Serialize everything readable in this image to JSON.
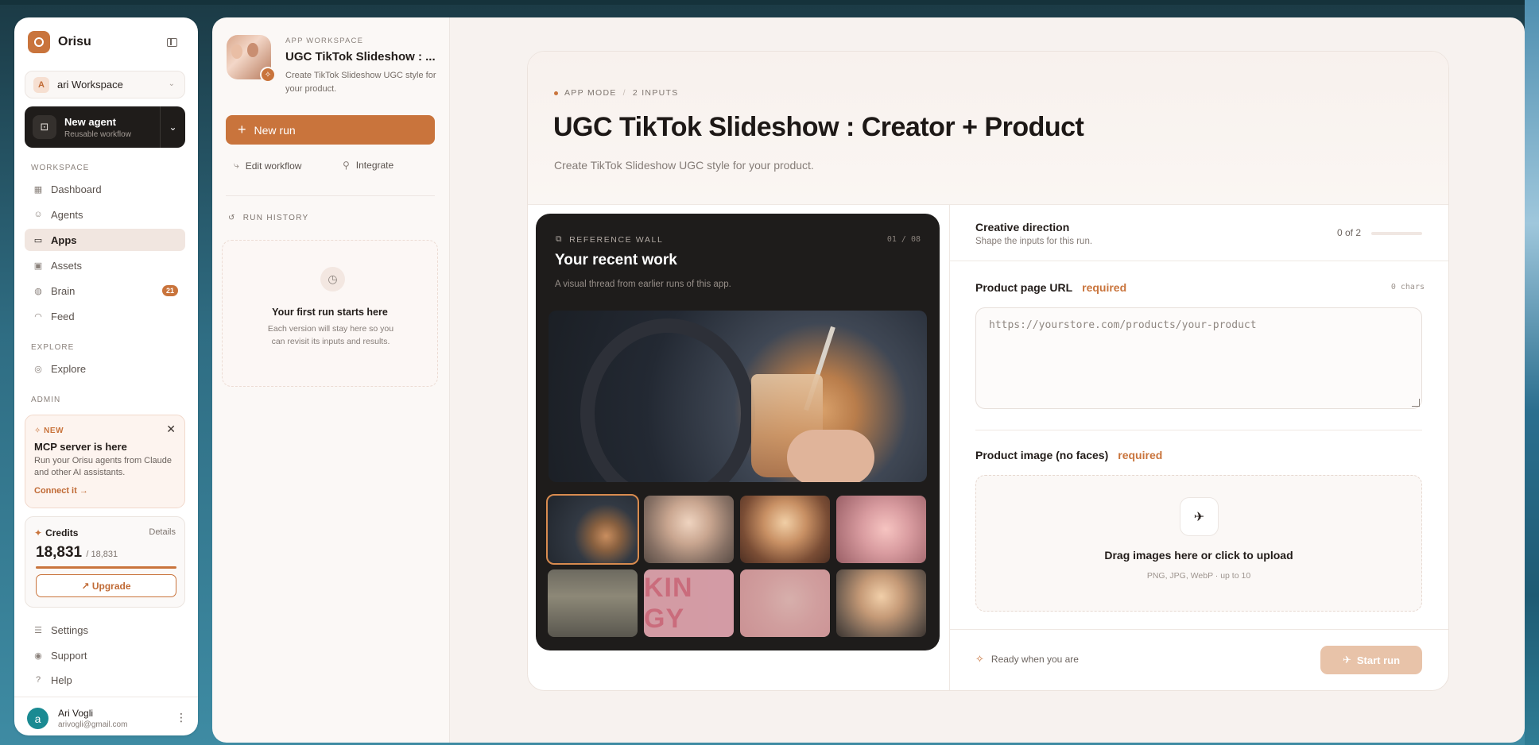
{
  "brand": {
    "name": "Orisu"
  },
  "workspace": {
    "avatar_letter": "A",
    "name": "ari Workspace"
  },
  "new_agent": {
    "title": "New agent",
    "subtitle": "Reusable workflow"
  },
  "sidebar": {
    "workspace_label": "WORKSPACE",
    "items": [
      {
        "label": "Dashboard",
        "icon": "grid-icon"
      },
      {
        "label": "Agents",
        "icon": "bot-icon"
      },
      {
        "label": "Apps",
        "icon": "app-window-icon",
        "active": true
      },
      {
        "label": "Assets",
        "icon": "image-icon"
      },
      {
        "label": "Brain",
        "icon": "brain-icon",
        "badge": "21"
      },
      {
        "label": "Feed",
        "icon": "rss-icon"
      }
    ],
    "explore_label": "EXPLORE",
    "explore_items": [
      {
        "label": "Explore",
        "icon": "compass-icon"
      }
    ],
    "admin_label": "ADMIN",
    "footer_items": [
      {
        "label": "Settings",
        "icon": "sliders-icon"
      },
      {
        "label": "Support",
        "icon": "lifebuoy-icon"
      },
      {
        "label": "Help",
        "icon": "help-circle-icon"
      }
    ]
  },
  "mcp_card": {
    "tag": "NEW",
    "title": "MCP server is here",
    "description": "Run your Orisu agents from Claude and other AI assistants.",
    "link": "Connect it →"
  },
  "credits": {
    "title": "Credits",
    "details_label": "Details",
    "value": "18,831",
    "total": "/ 18,831",
    "fill_fraction": 1.0,
    "upgrade_label": "↗ Upgrade"
  },
  "user": {
    "avatar_letter": "a",
    "name": "Ari Vogli",
    "email": "arivogli@gmail.com"
  },
  "app_column": {
    "eyebrow": "APP WORKSPACE",
    "name": "UGC TikTok Slideshow : ...",
    "description": "Create TikTok Slideshow UGC style for your product.",
    "new_run_label": "New run",
    "edit_workflow_label": "Edit workflow",
    "integrate_label": "Integrate",
    "run_history_label": "RUN HISTORY",
    "history_empty_title": "Your first run starts here",
    "history_empty_desc": "Each version will stay here so you can revisit its inputs and results."
  },
  "app_header": {
    "mode_label": "APP MODE",
    "separator": "/",
    "inputs_label": "2 INPUTS",
    "title": "UGC TikTok Slideshow : Creator + Product",
    "subtitle": "Create TikTok Slideshow UGC style for your product."
  },
  "reference_wall": {
    "label": "REFERENCE WALL",
    "counter": "01 / 08",
    "title": "Your recent work",
    "subtitle": "A visual thread from earlier runs of this app.",
    "thumb_text": "KIN GY"
  },
  "form": {
    "section_title": "Creative direction",
    "section_subtitle": "Shape the inputs for this run.",
    "progress_text": "0 of 2",
    "progress_fraction": 0,
    "url_label": "Product page URL",
    "required_label": "required",
    "chars_label": "0 chars",
    "url_placeholder": "https://yourstore.com/products/your-product",
    "image_label": "Product image (no faces)",
    "upload_title": "Drag images here or click to upload",
    "upload_subtitle": "PNG, JPG, WebP · up to 10",
    "ready_text": "Ready when you are",
    "start_label": "Start run"
  }
}
